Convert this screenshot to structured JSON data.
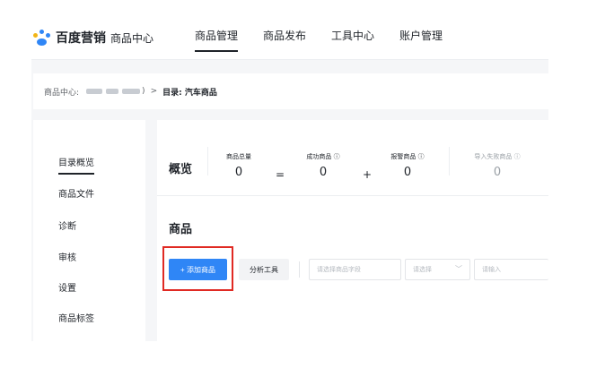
{
  "brand": {
    "name": "百度营销",
    "sub": "商品中心"
  },
  "nav": [
    "商品管理",
    "商品发布",
    "工具中心",
    "账户管理"
  ],
  "breadcrumb": {
    "prefix": "商品中心:",
    "suffix": ")",
    "sep": ">",
    "current": "目录: 汽车商品"
  },
  "sidebar": [
    "目录概览",
    "商品文件",
    "诊断",
    "审核",
    "设置",
    "商品标签"
  ],
  "overview": {
    "title": "概览",
    "stats": [
      {
        "label": "商品总量",
        "value": "0"
      },
      {
        "label": "成功商品 ⓘ",
        "value": "0"
      },
      {
        "label": "报警商品 ⓘ",
        "value": "0"
      },
      {
        "label": "导入失败商品 ⓘ",
        "value": "0"
      }
    ],
    "ops": [
      "=",
      "+"
    ]
  },
  "section": {
    "title": "商品",
    "add_label": "+ 添加商品",
    "tool_label": "分析工具",
    "field_placeholder": "请选择商品字段",
    "select_placeholder": "请选择",
    "input_placeholder": "请输入"
  },
  "colors": {
    "accent": "#2f86f6",
    "highlight": "#e02a23"
  }
}
